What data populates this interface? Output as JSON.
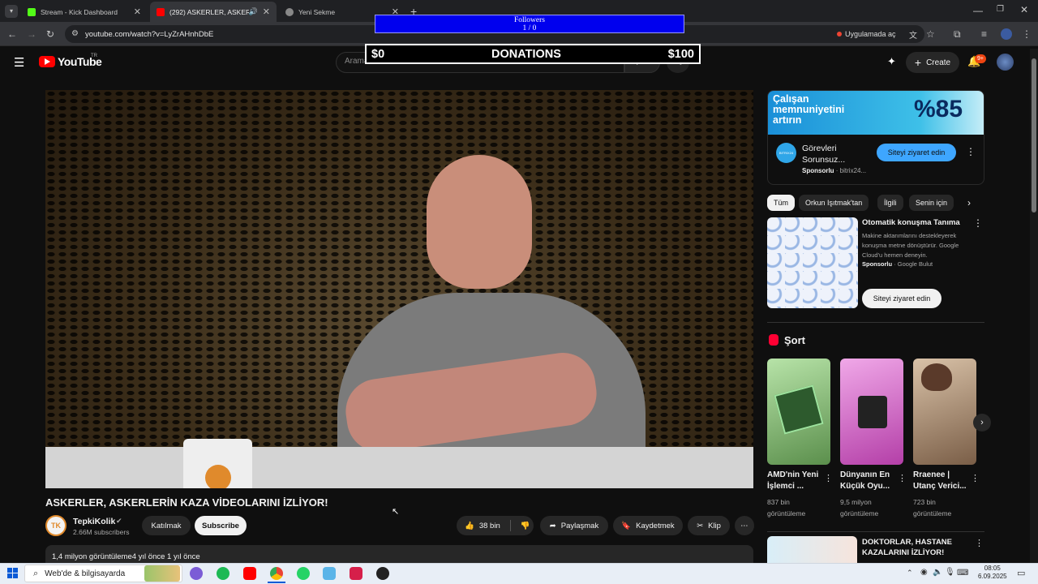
{
  "browser": {
    "tabs": [
      {
        "label": "Stream - Kick Dashboard",
        "favicon_color": "#53fc18"
      },
      {
        "label": "(292) ASKERLER, ASKERLERİ",
        "favicon_color": "#ff0000"
      },
      {
        "label": "Yeni Sekme",
        "favicon_color": "#888888"
      }
    ],
    "url": "youtube.com/watch?v=LyZrAHnhDbE",
    "open_in_app": "Uygulamada aç"
  },
  "overlay": {
    "followers_label": "Followers",
    "followers_count": "1 / 0",
    "donations_left": "$0",
    "donations_title": "DONATIONS",
    "donations_right": "$100"
  },
  "youtube": {
    "logo_text": "YouTube",
    "region": "TR",
    "search_placeholder": "Aramak",
    "create_label": "Create",
    "notif_badge": "9+"
  },
  "video": {
    "title": "ASKERLER, ASKERLERİN KAZA VİDEOLARINI İZLİYOR!",
    "channel": "TepkiKolik",
    "channel_initials": "TK",
    "subscribers": "2.66M subscribers",
    "join_label": "Katılmak",
    "subscribe_label": "Subscribe",
    "likes": "38 bin",
    "share_label": "Paylaşmak",
    "save_label": "Kaydetmek",
    "clip_label": "Klip",
    "views_text": "1,4 milyon görüntüleme4 yıl önce  1 yıl önce"
  },
  "ad1": {
    "banner_line1": "Çalışan",
    "banner_line2": "memnuniyetini",
    "banner_line3": "artırın",
    "banner_percent": "%85",
    "title": "Görevleri Sorunsuz...",
    "sponsor": "Sponsorlu",
    "domain": "· bitrix24...",
    "cta": "Siteyi ziyaret edin",
    "logo_text": "BITRIX24"
  },
  "chips": [
    "Tüm",
    "Orkun Işıtmak'tan",
    "İlgili",
    "Senin için"
  ],
  "ad2": {
    "title": "Otomatik konuşma Tanıma",
    "desc": "Makine aktarımlarını destekleyerek konuşma metne dönüştürür. Google Cloud'u hemen deneyin.",
    "sponsor": "Sponsorlu",
    "domain": "· Google Bulut",
    "cta": "Siteyi ziyaret edin"
  },
  "shorts": {
    "heading": "Şort",
    "items": [
      {
        "title": "AMD'nin Yeni İşlemci ...",
        "views": "837 bin görüntüleme",
        "thumb_color": "#9fd48f"
      },
      {
        "title": "Dünyanın En Küçük Oyu...",
        "views": "9,5 milyon görüntüleme",
        "thumb_color": "#e07ac8"
      },
      {
        "title": "Rraenee | Utanç Verici...",
        "views": "723 bin görüntüleme",
        "thumb_color": "#c9a88c"
      }
    ]
  },
  "next_video": {
    "title": "DOKTORLAR, HASTANE KAZALARINI İZLİYOR!"
  },
  "taskbar": {
    "search_text": "Web'de & bilgisayarda",
    "time": "08:05",
    "date": "6.09.2025"
  }
}
